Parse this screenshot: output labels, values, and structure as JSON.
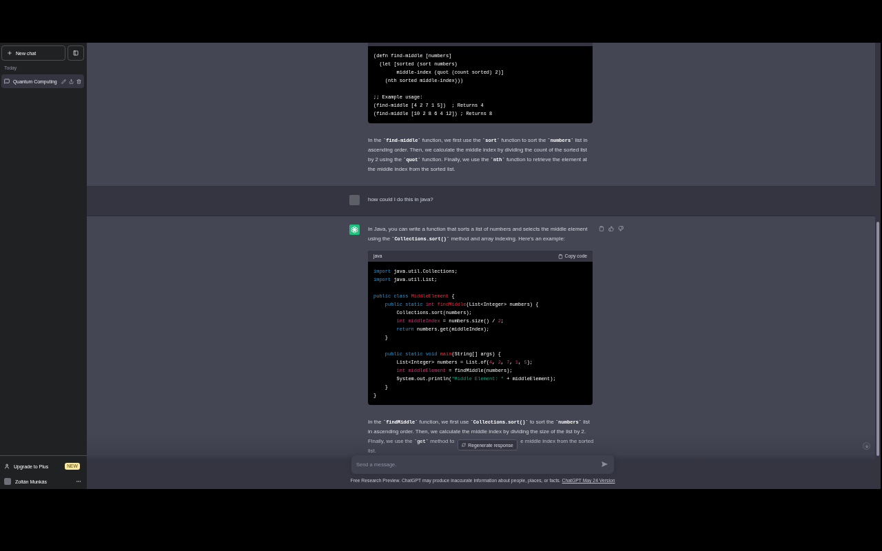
{
  "sidebar": {
    "new_chat": {
      "label": "New chat"
    },
    "section_label": "Today",
    "conversations": [
      {
        "title": "Quantum Computing",
        "selected": true
      }
    ],
    "upgrade": {
      "label": "Upgrade to Plus",
      "badge": "NEW"
    },
    "user": {
      "name": "Zoltán Munkás"
    }
  },
  "messages": [
    {
      "kind": "assistant",
      "partial": true,
      "blocks": [
        {
          "kind": "code",
          "groups": [
            [
              {
                "tokens": [
                  {
                    "kind": "plain",
                    "text": "(defn find-middle [numbers]"
                  }
                ]
              },
              {
                "tokens": [
                  {
                    "kind": "plain",
                    "text": "  (let [sorted (sort numbers)"
                  }
                ]
              },
              {
                "tokens": [
                  {
                    "kind": "plain",
                    "text": "        middle-index (quot (count sorted) 2)]"
                  }
                ]
              },
              {
                "tokens": [
                  {
                    "kind": "plain",
                    "text": "    (nth sorted middle-index)))"
                  }
                ]
              }
            ],
            [
              {
                "tokens": [
                  {
                    "kind": "plain",
                    "text": ";; Example usage:"
                  }
                ]
              },
              {
                "tokens": [
                  {
                    "kind": "plain",
                    "text": "(find-middle [4 2 7 1 5])  ; Returns 4"
                  }
                ]
              },
              {
                "tokens": [
                  {
                    "kind": "plain",
                    "text": "(find-middle [10 2 8 6 4 12]) ; Returns 8"
                  }
                ]
              }
            ]
          ]
        },
        {
          "kind": "paragraph",
          "segments": [
            {
              "kind": "text",
              "text": "In the "
            },
            {
              "kind": "code",
              "text": "`find-middle`"
            },
            {
              "kind": "text",
              "text": " function, we first use the "
            },
            {
              "kind": "code",
              "text": "`sort`"
            },
            {
              "kind": "text",
              "text": " function to sort the "
            },
            {
              "kind": "code",
              "text": "`numbers`"
            },
            {
              "kind": "text",
              "text": " list in ascending order. Then, we calculate the middle index by dividing the count of the sorted list by 2 using the "
            },
            {
              "kind": "code",
              "text": "`quot`"
            },
            {
              "kind": "text",
              "text": " function. Finally, we use the "
            },
            {
              "kind": "code",
              "text": "`nth`"
            },
            {
              "kind": "text",
              "text": " function to retrieve the element at the middle index from the sorted list."
            }
          ]
        }
      ]
    },
    {
      "kind": "user",
      "partial": false,
      "blocks": [
        {
          "kind": "paragraph",
          "segments": [
            {
              "kind": "text",
              "text": "how could I do this in java?"
            }
          ]
        }
      ]
    },
    {
      "kind": "assistant",
      "partial": false,
      "blocks": [
        {
          "kind": "paragraph",
          "segments": [
            {
              "kind": "text",
              "text": "In Java, you can write a function that sorts a list of numbers and selects the middle element using the "
            },
            {
              "kind": "code",
              "text": "`Collections.sort()`"
            },
            {
              "kind": "text",
              "text": " method and array indexing. Here's an example:"
            }
          ]
        },
        {
          "kind": "code",
          "language": "java",
          "copy_label": "Copy code",
          "groups": [
            [
              {
                "tokens": [
                  {
                    "kind": "keyword",
                    "text": "import"
                  },
                  {
                    "kind": "plain",
                    "text": " java.util.Collections;"
                  }
                ]
              },
              {
                "tokens": [
                  {
                    "kind": "keyword",
                    "text": "import"
                  },
                  {
                    "kind": "plain",
                    "text": " java.util.List;"
                  }
                ]
              }
            ],
            [
              {
                "tokens": [
                  {
                    "kind": "keyword",
                    "text": "public "
                  },
                  {
                    "kind": "keyword",
                    "text": "class "
                  },
                  {
                    "kind": "title",
                    "text": "MiddleElement"
                  },
                  {
                    "kind": "plain",
                    "text": " {"
                  }
                ]
              },
              {
                "tokens": [
                  {
                    "kind": "keyword",
                    "text": "    public "
                  },
                  {
                    "kind": "keyword",
                    "text": "static "
                  },
                  {
                    "kind": "type",
                    "text": "int "
                  },
                  {
                    "kind": "title",
                    "text": "findMiddle"
                  },
                  {
                    "kind": "plain",
                    "text": "(List<Integer> numbers) {"
                  }
                ]
              },
              {
                "tokens": [
                  {
                    "kind": "plain",
                    "text": "        Collections.sort(numbers);"
                  }
                ]
              },
              {
                "tokens": [
                  {
                    "kind": "type",
                    "text": "        int "
                  },
                  {
                    "kind": "variable",
                    "text": "middleIndex"
                  },
                  {
                    "kind": "plain",
                    "text": " = numbers.size() / "
                  },
                  {
                    "kind": "number",
                    "text": "2"
                  },
                  {
                    "kind": "plain",
                    "text": ";"
                  }
                ]
              },
              {
                "tokens": [
                  {
                    "kind": "keyword",
                    "text": "        return"
                  },
                  {
                    "kind": "plain",
                    "text": " numbers.get(middleIndex);"
                  }
                ]
              },
              {
                "tokens": [
                  {
                    "kind": "plain",
                    "text": "    }"
                  }
                ]
              }
            ],
            [
              {
                "tokens": [
                  {
                    "kind": "keyword",
                    "text": "    public "
                  },
                  {
                    "kind": "keyword",
                    "text": "static "
                  },
                  {
                    "kind": "keyword",
                    "text": "void "
                  },
                  {
                    "kind": "title",
                    "text": "main"
                  },
                  {
                    "kind": "plain",
                    "text": "(String[] args) {"
                  }
                ]
              },
              {
                "tokens": [
                  {
                    "kind": "plain",
                    "text": "        List<Integer> numbers = List.of("
                  },
                  {
                    "kind": "number",
                    "text": "4"
                  },
                  {
                    "kind": "plain",
                    "text": ", "
                  },
                  {
                    "kind": "number",
                    "text": "2"
                  },
                  {
                    "kind": "plain",
                    "text": ", "
                  },
                  {
                    "kind": "number",
                    "text": "7"
                  },
                  {
                    "kind": "plain",
                    "text": ", "
                  },
                  {
                    "kind": "number",
                    "text": "1"
                  },
                  {
                    "kind": "plain",
                    "text": ", "
                  },
                  {
                    "kind": "number",
                    "text": "5"
                  },
                  {
                    "kind": "plain",
                    "text": ");"
                  }
                ]
              },
              {
                "tokens": [
                  {
                    "kind": "type",
                    "text": "        int "
                  },
                  {
                    "kind": "variable",
                    "text": "middleElement"
                  },
                  {
                    "kind": "plain",
                    "text": " = findMiddle(numbers);"
                  }
                ]
              },
              {
                "tokens": [
                  {
                    "kind": "plain",
                    "text": "        System.out.println("
                  },
                  {
                    "kind": "string",
                    "text": "\"Middle Element: \""
                  },
                  {
                    "kind": "plain",
                    "text": " + middleElement);"
                  }
                ]
              },
              {
                "tokens": [
                  {
                    "kind": "plain",
                    "text": "    }"
                  }
                ]
              },
              {
                "tokens": [
                  {
                    "kind": "plain",
                    "text": "}"
                  }
                ]
              }
            ]
          ]
        },
        {
          "kind": "paragraph",
          "lines": [
            [
              {
                "kind": "text",
                "text": "In the "
              },
              {
                "kind": "code",
                "text": "`findMiddle`"
              },
              {
                "kind": "text",
                "text": " function, we first use "
              },
              {
                "kind": "code",
                "text": "`Collections.sort()`"
              },
              {
                "kind": "text",
                "text": " to sort the "
              },
              {
                "kind": "code",
                "text": "`numbers`"
              },
              {
                "kind": "text",
                "text": " list"
              }
            ],
            [
              {
                "kind": "text",
                "text": "in ascending order. Then, we calculate the middle index by dividing the size of the list by 2."
              }
            ],
            [
              {
                "kind": "text",
                "text": "Finally, we use the "
              },
              {
                "kind": "code",
                "text": "`get`"
              },
              {
                "kind": "text",
                "text": " method to"
              },
              {
                "kind": "covered"
              },
              {
                "kind": "text",
                "text": "e middle index from the sorted"
              }
            ],
            [
              {
                "kind": "text",
                "text": "list."
              }
            ]
          ]
        }
      ]
    }
  ],
  "composer": {
    "regenerate_label": "Regenerate response",
    "placeholder": "Send a message.",
    "disclaimer": "Free Research Preview. ChatGPT may produce inaccurate information about people, places, or facts.",
    "version_link": "ChatGPT May 24 Version"
  }
}
